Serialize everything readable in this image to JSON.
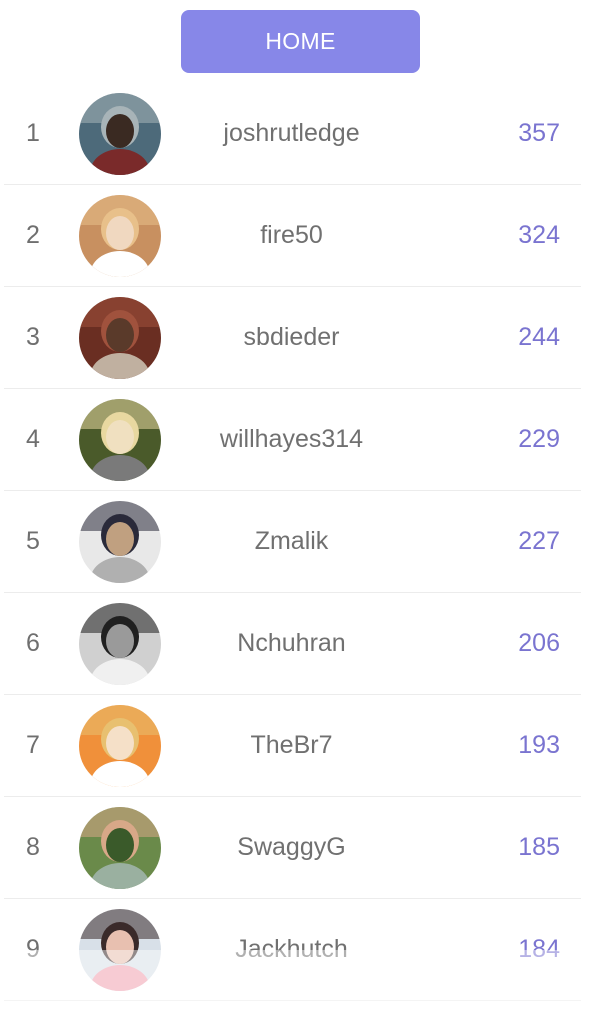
{
  "header": {
    "home_label": "HOME"
  },
  "leaderboard": [
    {
      "rank": "1",
      "username": "joshrutledge",
      "score": "357",
      "avatar_colors": [
        "#4d6a7a",
        "#a8b4b8",
        "#3a2a22",
        "#7a2a2a"
      ]
    },
    {
      "rank": "2",
      "username": "fire50",
      "score": "324",
      "avatar_colors": [
        "#c89060",
        "#e8c08a",
        "#f0d8c0",
        "#ffffff"
      ]
    },
    {
      "rank": "3",
      "username": "sbdieder",
      "score": "244",
      "avatar_colors": [
        "#6a2e22",
        "#a0523d",
        "#5a3a2a",
        "#c0b0a0"
      ]
    },
    {
      "rank": "4",
      "username": "willhayes314",
      "score": "229",
      "avatar_colors": [
        "#4a5a2a",
        "#e8d8a0",
        "#f0e0c0",
        "#7a7a7a"
      ]
    },
    {
      "rank": "5",
      "username": "Zmalik",
      "score": "227",
      "avatar_colors": [
        "#e8e8e8",
        "#2a2a3a",
        "#c0a080",
        "#b0b0b0"
      ]
    },
    {
      "rank": "6",
      "username": "Nchuhran",
      "score": "206",
      "avatar_colors": [
        "#d0d0d0",
        "#202020",
        "#9a9a9a",
        "#f0f0f0"
      ]
    },
    {
      "rank": "7",
      "username": "TheBr7",
      "score": "193",
      "avatar_colors": [
        "#f0903a",
        "#e8c070",
        "#f5e0c8",
        "#ffffff"
      ]
    },
    {
      "rank": "8",
      "username": "SwaggyG",
      "score": "185",
      "avatar_colors": [
        "#6a8a4a",
        "#d8a888",
        "#3a5a2a",
        "#9ab0a0"
      ]
    },
    {
      "rank": "9",
      "username": "Jackhutch",
      "score": "184",
      "avatar_colors": [
        "#d8e0e8",
        "#3a2a2a",
        "#e8c0b0",
        "#f0a0b0"
      ]
    }
  ]
}
